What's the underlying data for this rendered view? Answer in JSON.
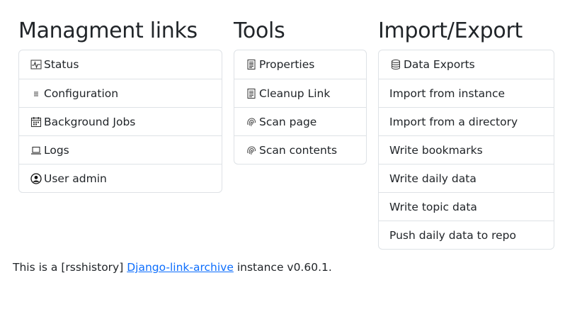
{
  "management": {
    "title": "Managment links",
    "items": [
      {
        "label": "Status",
        "icon": "heartbeat-icon"
      },
      {
        "label": "Configuration",
        "icon": "list-icon"
      },
      {
        "label": "Background Jobs",
        "icon": "calendar-icon"
      },
      {
        "label": "Logs",
        "icon": "laptop-icon"
      },
      {
        "label": "User admin",
        "icon": "user-circle-icon"
      }
    ]
  },
  "tools": {
    "title": "Tools",
    "items": [
      {
        "label": "Properties",
        "icon": "document-icon"
      },
      {
        "label": "Cleanup Link",
        "icon": "document-icon"
      },
      {
        "label": "Scan page",
        "icon": "fingerprint-icon"
      },
      {
        "label": "Scan contents",
        "icon": "fingerprint-icon"
      }
    ]
  },
  "import_export": {
    "title": "Import/Export",
    "items": [
      {
        "label": "Data Exports",
        "icon": "database-icon"
      },
      {
        "label": "Import from instance"
      },
      {
        "label": "Import from a directory"
      },
      {
        "label": "Write bookmarks"
      },
      {
        "label": "Write daily data"
      },
      {
        "label": "Write topic data"
      },
      {
        "label": "Push daily data to repo"
      }
    ]
  },
  "footer": {
    "prefix": "This is a [rsshistory]",
    "link": "Django-link-archive",
    "suffix": "instance v0.60.1."
  },
  "colors": {
    "link": "#0d6efd",
    "border": "#dee2e6",
    "text": "#212529"
  }
}
